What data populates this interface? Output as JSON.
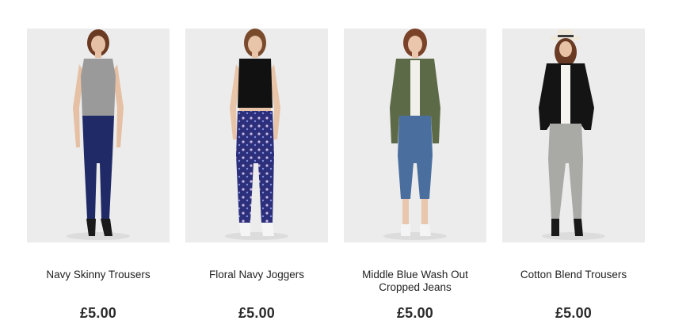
{
  "products": [
    {
      "name": "Navy Skinny Trousers",
      "price": "£5.00"
    },
    {
      "name": "Floral Navy Joggers",
      "price": "£5.00"
    },
    {
      "name": "Middle Blue Wash Out Cropped Jeans",
      "price": "£5.00"
    },
    {
      "name": "Cotton Blend Trousers",
      "price": "£5.00"
    }
  ],
  "colors": {
    "photo_background": "#ececec",
    "text": "#222222"
  }
}
